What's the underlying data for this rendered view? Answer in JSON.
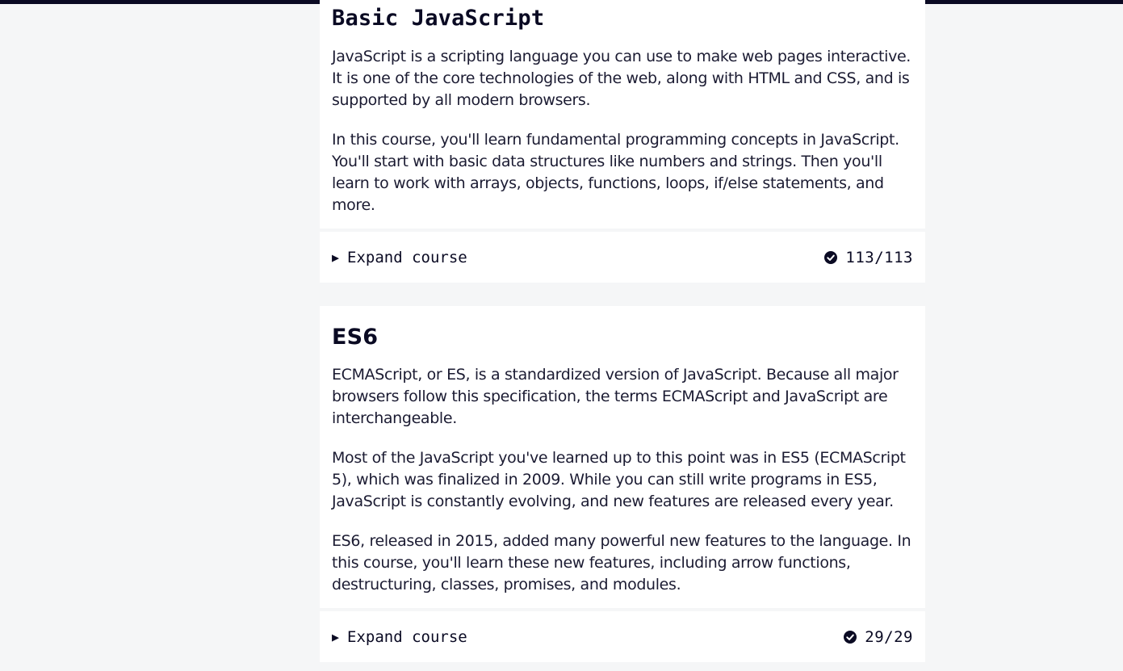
{
  "blocks": [
    {
      "title": "Basic JavaScript",
      "paragraphs": [
        "JavaScript is a scripting language you can use to make web pages interactive. It is one of the core technologies of the web, along with HTML and CSS, and is supported by all modern browsers.",
        "In this course, you'll learn fundamental programming concepts in JavaScript. You'll start with basic data structures like numbers and strings. Then you'll learn to work with arrays, objects, functions, loops, if/else statements, and more."
      ],
      "expand_label": "Expand course",
      "progress": "113/113"
    },
    {
      "title": "ES6",
      "paragraphs": [
        "ECMAScript, or ES, is a standardized version of JavaScript. Because all major browsers follow this specification, the terms ECMAScript and JavaScript are interchangeable.",
        "Most of the JavaScript you've learned up to this point was in ES5 (ECMAScript 5), which was finalized in 2009. While you can still write programs in ES5, JavaScript is constantly evolving, and new features are released every year.",
        "ES6, released in 2015, added many powerful new features to the language. In this course, you'll learn these new features, including arrow functions, destructuring, classes, promises, and modules."
      ],
      "expand_label": "Expand course",
      "progress": "29/29"
    }
  ],
  "icons": {
    "expand": "caret-right-icon",
    "complete": "check-circle-icon"
  },
  "colors": {
    "topbar": "#0a0a23",
    "background": "#f5f6f7",
    "card": "#ffffff",
    "text": "#0a0a23"
  }
}
